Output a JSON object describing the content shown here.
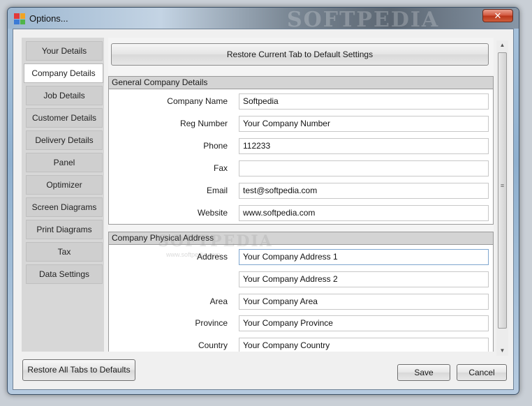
{
  "window": {
    "title": "Options...",
    "close_label": "✕",
    "watermark": "SOFTPEDIA"
  },
  "sidebar": {
    "items": [
      {
        "label": "Your Details"
      },
      {
        "label": "Company Details"
      },
      {
        "label": "Job Details"
      },
      {
        "label": "Customer Details"
      },
      {
        "label": "Delivery Details"
      },
      {
        "label": "Panel"
      },
      {
        "label": "Optimizer"
      },
      {
        "label": "Screen Diagrams"
      },
      {
        "label": "Print Diagrams"
      },
      {
        "label": "Tax"
      },
      {
        "label": "Data Settings"
      }
    ],
    "active": "Company Details"
  },
  "main": {
    "restore_tab_label": "Restore Current Tab to Default Settings",
    "general": {
      "header": "General Company Details",
      "fields": [
        {
          "label": "Company Name",
          "value": "Softpedia"
        },
        {
          "label": "Reg Number",
          "value": "Your Company Number"
        },
        {
          "label": "Phone",
          "value": "112233"
        },
        {
          "label": "Fax",
          "value": ""
        },
        {
          "label": "Email",
          "value": "test@softpedia.com"
        },
        {
          "label": "Website",
          "value": "www.softpedia.com"
        }
      ]
    },
    "address": {
      "header": "Company Physical Address",
      "watermark": "SOFTPEDIA",
      "watermark_url": "www.softpedia.com",
      "fields": [
        {
          "label": "Address",
          "value": "Your Company Address 1"
        },
        {
          "label": "",
          "value": "Your Company Address 2"
        },
        {
          "label": "Area",
          "value": "Your Company Area"
        },
        {
          "label": "Province",
          "value": "Your Company Province"
        },
        {
          "label": "Country",
          "value": "Your Company Country"
        }
      ]
    }
  },
  "footer": {
    "restore_all_label": "Restore All Tabs to Defaults",
    "save_label": "Save",
    "cancel_label": "Cancel"
  }
}
